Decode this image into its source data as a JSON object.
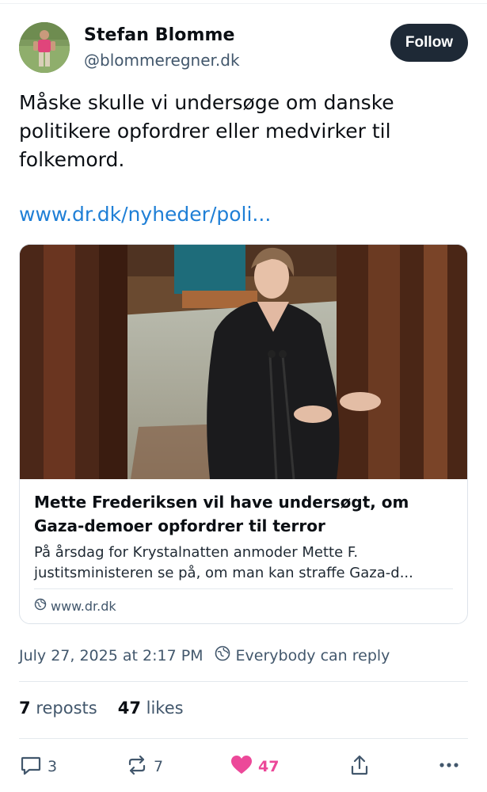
{
  "author": {
    "name": "Stefan Blomme",
    "handle": "@blommeregner.dk"
  },
  "follow_label": "Follow",
  "post": {
    "text": "Måske skulle vi undersøge om danske politikere opfordrer eller medvirker til folkemord.",
    "link_text": "www.dr.dk/nyheder/poli..."
  },
  "embed": {
    "title": "Mette Frederiksen vil have undersøgt, om Gaza-demoer opfordrer til terror",
    "description": "På årsdag for Krystalnatten anmoder Mette F. justitsministeren se på, om man kan straffe Gaza-d...",
    "domain": "www.dr.dk"
  },
  "meta": {
    "timestamp": "July 27, 2025 at 2:17 PM",
    "reply_setting": "Everybody can reply"
  },
  "stats": {
    "reposts_count": "7",
    "reposts_label": "reposts",
    "likes_count": "47",
    "likes_label": "likes"
  },
  "actions": {
    "replies": "3",
    "reposts": "7",
    "likes": "47"
  },
  "colors": {
    "link": "#1f7fd6",
    "like": "#ec4899",
    "follow_bg": "#1e2936"
  },
  "icons": [
    "reply-icon",
    "repost-icon",
    "heart-icon",
    "share-icon",
    "more-icon",
    "globe-icon",
    "reply-setting-icon"
  ]
}
